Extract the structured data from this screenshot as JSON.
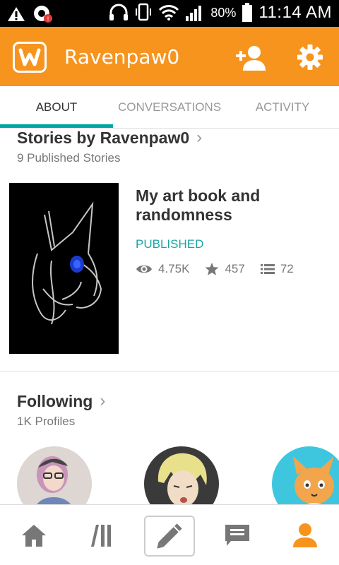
{
  "status_bar": {
    "battery_percent": "80%",
    "time": "11:14 AM"
  },
  "app_bar": {
    "logo_letter": "W",
    "username": "Ravenpaw0"
  },
  "tabs": [
    {
      "label": "ABOUT",
      "active": true
    },
    {
      "label": "CONVERSATIONS",
      "active": false
    },
    {
      "label": "ACTIVITY",
      "active": false
    }
  ],
  "stories": {
    "title": "Stories by Ravenpaw0",
    "subtitle": "9 Published Stories",
    "items": [
      {
        "title": "My art book and randomness",
        "status": "PUBLISHED",
        "reads": "4.75K",
        "votes": "457",
        "parts": "72"
      }
    ]
  },
  "following": {
    "title": "Following",
    "subtitle": "1K Profiles"
  },
  "colors": {
    "accent": "#f7941d",
    "teal": "#00a6a6",
    "nav_icon": "#777777"
  },
  "bottom_nav": [
    "home-icon",
    "library-icon",
    "write-icon",
    "messages-icon",
    "profile-icon"
  ]
}
